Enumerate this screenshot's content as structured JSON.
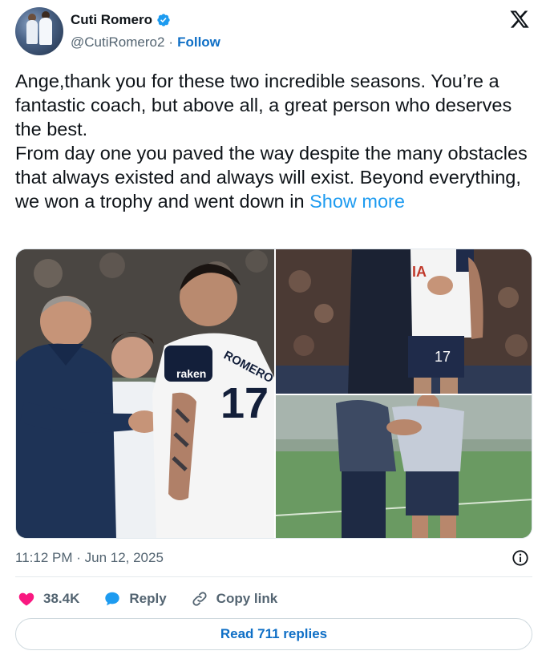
{
  "author": {
    "display_name": "Cuti Romero",
    "handle": "@CutiRomero2",
    "separator": "·",
    "follow_label": "Follow",
    "verified": true
  },
  "tweet": {
    "paragraph_1": "Ange,thank you for these two incredible seasons. You’re a fantastic coach, but above all, a great person who deserves the best.",
    "paragraph_2": "From day one you paved the way despite the many obstacles that always existed and always will exist. Beyond everything, we won a trophy and went down in ",
    "show_more": "Show more",
    "timestamp": "11:12 PM · Jun 12, 2025"
  },
  "media": {
    "photo_left_jersey_number": "17",
    "photo_left_sponsor": "raken",
    "photo_left_name": "ROMERO",
    "photo_top_right_jersey_number": "17",
    "photo_top_right_sponsor": "IA"
  },
  "actions": {
    "likes": "38.4K",
    "reply_label": "Reply",
    "copy_link_label": "Copy link"
  },
  "replies_button": "Read 711 replies",
  "colors": {
    "accent": "#1d9bf0",
    "link_dark": "#0f6fc6",
    "like_heart": "#f91880",
    "reply_bubble": "#1d9bf0",
    "text": "#0f1419",
    "muted": "#536471"
  },
  "icons": {
    "verified": "verified-badge-icon",
    "brand": "x-logo-icon",
    "info": "info-icon",
    "like": "heart-icon",
    "reply": "speech-bubble-icon",
    "copy_link": "link-icon"
  }
}
